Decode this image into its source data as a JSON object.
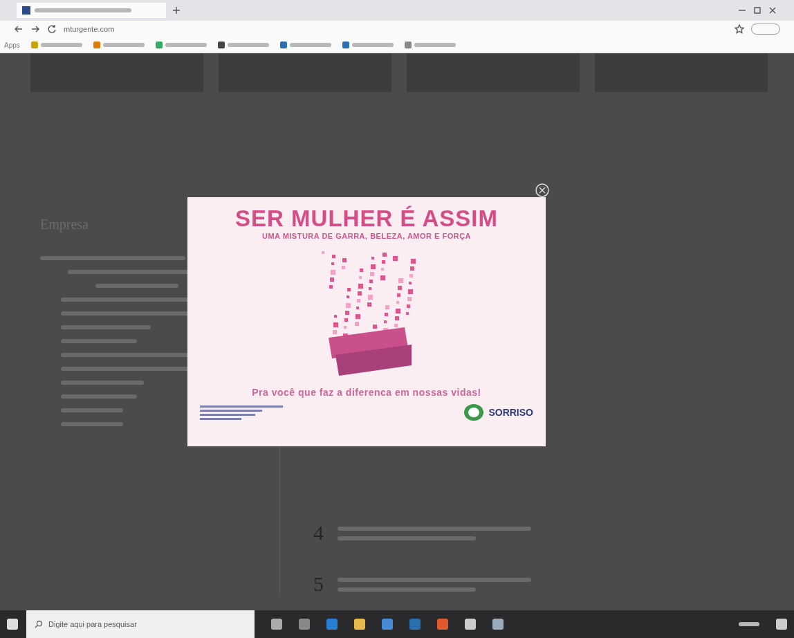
{
  "browser": {
    "url": "mturgente.com",
    "bookmarks": [
      "Apps"
    ]
  },
  "page": {
    "section_title": "Empresa",
    "list_numbers": [
      "4",
      "5"
    ]
  },
  "popup": {
    "title": "SER MULHER É ASSIM",
    "subtitle": "UMA MISTURA DE GARRA, BELEZA, AMOR E FORÇA",
    "tagline": "Pra você que faz a diferenca em nossas vidas!",
    "brand": "SORRISO"
  },
  "taskbar": {
    "search": {
      "placeholder": "Digite aqui para pesquisar"
    }
  }
}
